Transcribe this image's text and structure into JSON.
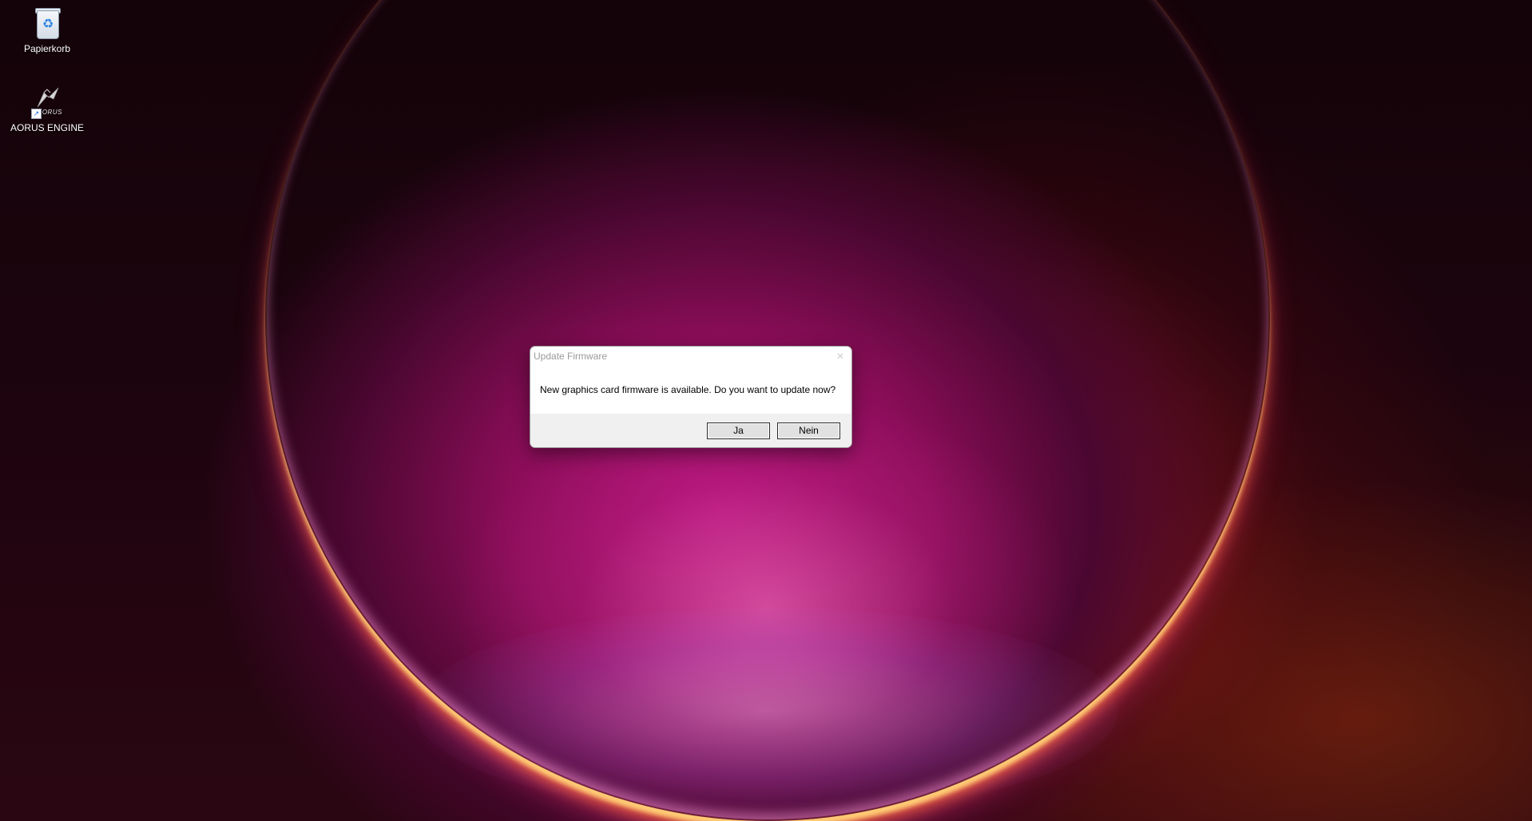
{
  "desktop": {
    "icons": [
      {
        "label": "Papierkorb",
        "icon": "recycle-bin-icon"
      },
      {
        "label": "AORUS ENGINE",
        "icon": "aorus-engine-icon",
        "logo_text": "AORUS"
      }
    ]
  },
  "dialog": {
    "title": "Update Firmware",
    "close_glyph": "✕",
    "message": "New graphics card firmware is available. Do you want to update now?",
    "yes_label": "Ja",
    "no_label": "Nein"
  },
  "colors": {
    "dialog_background": "#ffffff",
    "button_bar": "#f0f0f0",
    "button_face": "#e1e1e1",
    "title_text": "#9a9a9a"
  }
}
